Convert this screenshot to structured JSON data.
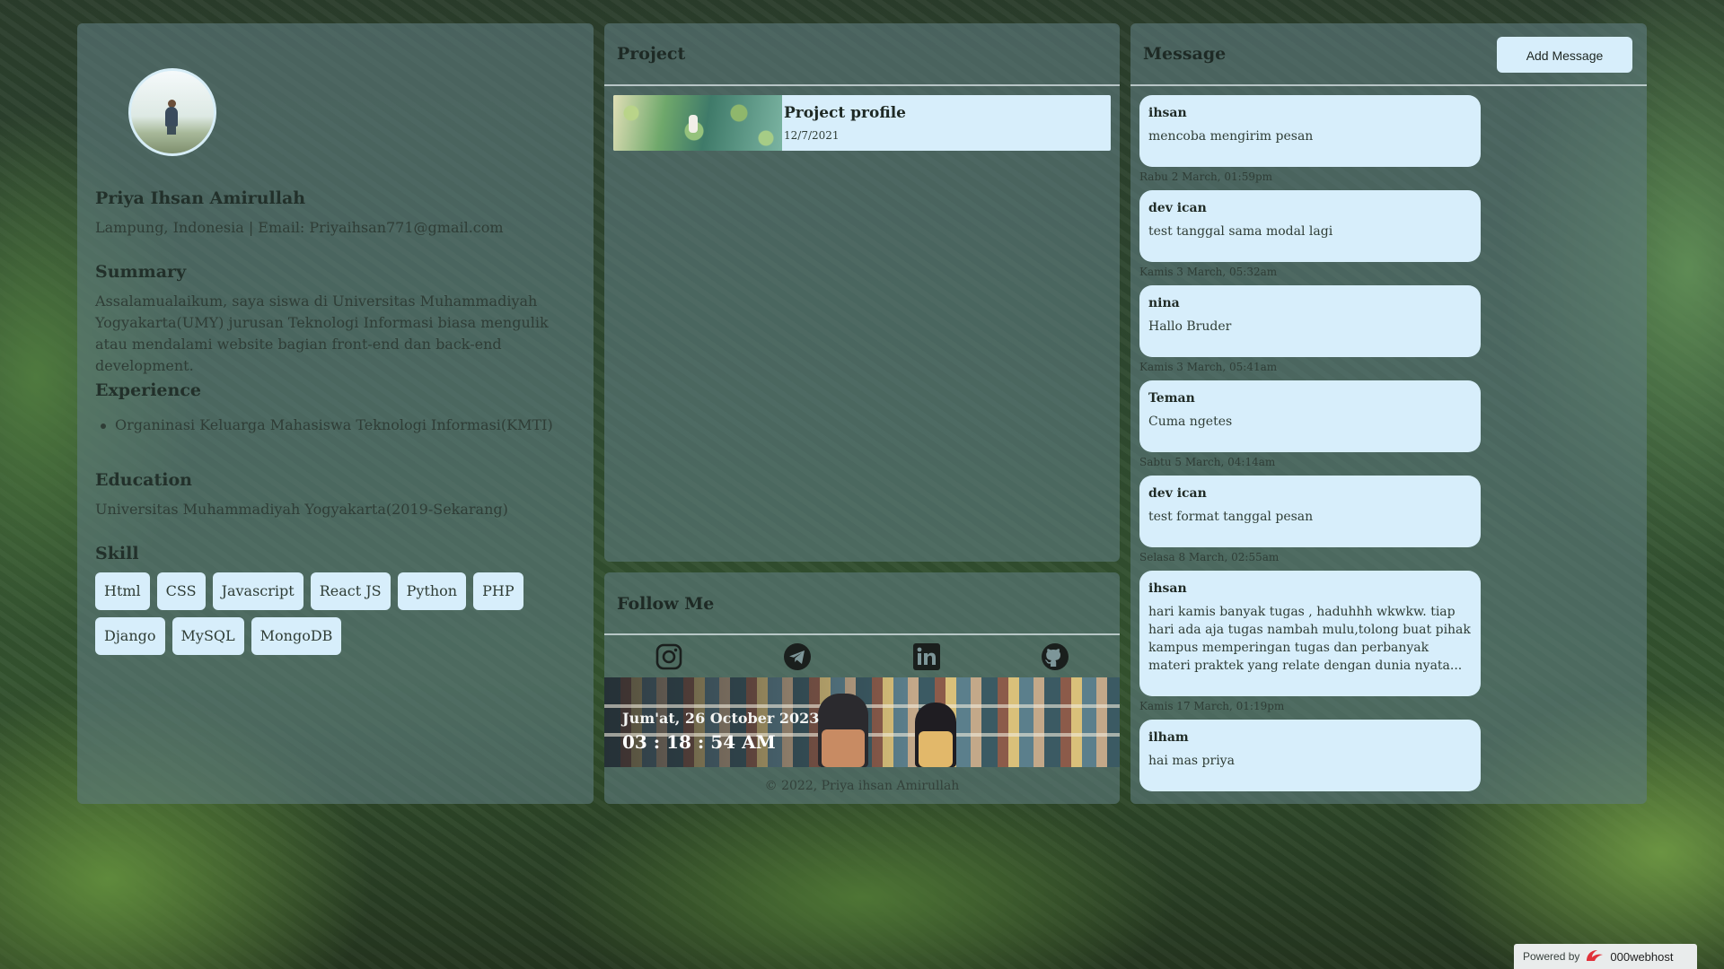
{
  "profile": {
    "name": "Priya Ihsan Amirullah",
    "contact": "Lampung, Indonesia | Email: Priyaihsan771@gmail.com",
    "summary_title": "Summary",
    "summary_text": "Assalamualaikum, saya siswa di Universitas Muhammadiyah Yogyakarta(UMY) jurusan Teknologi Informasi biasa mengulik atau mendalami website bagian front-end dan back-end development.",
    "experience_title": "Experience",
    "experience_items": [
      "Organinasi Keluarga Mahasiswa Teknologi Informasi(KMTI)"
    ],
    "education_title": "Education",
    "education_text": "Universitas Muhammadiyah Yogyakarta(2019-Sekarang)",
    "skill_title": "Skill",
    "skills": [
      "Html",
      "CSS",
      "Javascript",
      "React JS",
      "Python",
      "PHP",
      "Django",
      "MySQL",
      "MongoDB"
    ]
  },
  "project": {
    "title": "Project",
    "items": [
      {
        "name": "Project profile",
        "date": "12/7/2021"
      }
    ]
  },
  "follow": {
    "title": "Follow Me",
    "icons": [
      "instagram-icon",
      "telegram-icon",
      "linkedin-icon",
      "github-icon"
    ],
    "date": "Jum'at, 26 October 2023",
    "time": "03 : 18 : 54 AM",
    "copyright": "© 2022, Priya ihsan Amirullah"
  },
  "message": {
    "title": "Message",
    "add_button": "Add Message",
    "items": [
      {
        "name": "ihsan",
        "text": "mencoba mengirim pesan",
        "time": "Rabu 2 March, 01:59pm"
      },
      {
        "name": "dev ican",
        "text": "test tanggal sama modal lagi",
        "time": "Kamis 3 March, 05:32am"
      },
      {
        "name": "nina",
        "text": "Hallo Bruder",
        "time": "Kamis 3 March, 05:41am"
      },
      {
        "name": "Teman",
        "text": "Cuma ngetes",
        "time": "Sabtu 5 March, 04:14am"
      },
      {
        "name": "dev ican",
        "text": "test format tanggal pesan",
        "time": "Selasa 8 March, 02:55am"
      },
      {
        "name": "ihsan",
        "text": "hari kamis banyak tugas , haduhhh wkwkw. tiap hari ada aja tugas nambah mulu,tolong buat pihak kampus memperingan tugas dan perbanyak materi praktek yang relate dengan dunia nyata...",
        "time": "Kamis 17 March, 01:19pm"
      },
      {
        "name": "ilham",
        "text": "hai mas priya",
        "time": ""
      }
    ]
  },
  "powered": {
    "label": "Powered by",
    "brand": "000webhost"
  },
  "colors": {
    "card": "#d7eefb",
    "panel": "#5e7a7e"
  }
}
